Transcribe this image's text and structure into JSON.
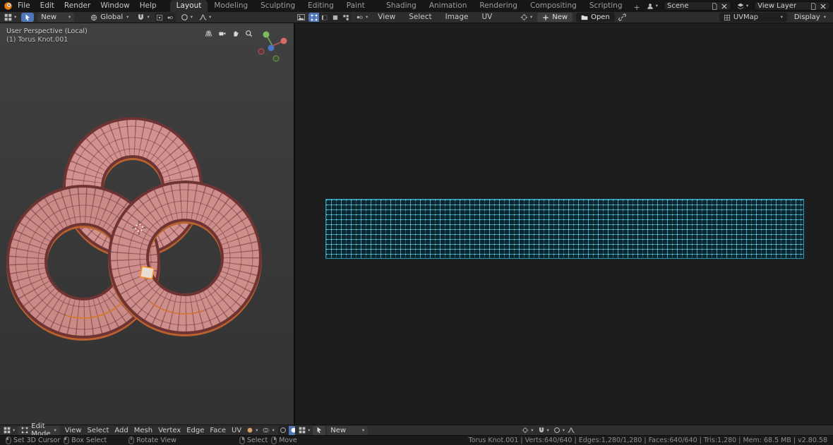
{
  "topbar": {
    "menus": [
      "File",
      "Edit",
      "Render",
      "Window",
      "Help"
    ],
    "tabs": [
      "Layout",
      "Modeling",
      "Sculpting",
      "UV Editing",
      "Texture Paint",
      "Shading",
      "Animation",
      "Rendering",
      "Compositing",
      "Scripting"
    ],
    "active_tab": "Layout",
    "add_tab": "+",
    "scene_label": "Scene",
    "view_layer_label": "View Layer"
  },
  "tools": {
    "new_label": "New",
    "orientation": "Global"
  },
  "uv": {
    "menus": [
      "View",
      "Select",
      "Image",
      "UV"
    ],
    "new_button": "New",
    "open_button": "Open",
    "uvmap": "UVMap",
    "display": "Display",
    "image_new": "New"
  },
  "vp": {
    "view_label": "User Perspective (Local)",
    "object_label": "(1) Torus Knot.001",
    "mode": "Edit Mode",
    "menus": [
      "View",
      "Select",
      "Add",
      "Mesh",
      "Vertex",
      "Edge",
      "Face",
      "UV"
    ]
  },
  "status": {
    "set_cursor": "Set 3D Cursor",
    "box_select": "Box Select",
    "rotate_view": "Rotate View",
    "select": "Select",
    "move": "Move",
    "stats": "Torus Knot.001 | Verts:640/640 | Edges:1,280/1,280 | Faces:640/640 | Tris:1,280 | Mem: 68.5 MB | v2.80.58"
  },
  "colors": {
    "accent_blue": "#4f76b8",
    "mesh_fill": "#cf8f8d",
    "mesh_edge": "#6e3434",
    "selection_orange": "#e8822e",
    "uv_line": "#3aa0b8",
    "uv_vertex": "#a8ecff",
    "viewport_bg": "#3a3a3a",
    "uv_bg": "#1d1d1d"
  },
  "icons": {
    "blender-logo": "orange circle logo",
    "cursor-icon": "white arrow pointer",
    "magnet-icon": "snapping magnet",
    "proportional-icon": "circle",
    "falloff-icon": "smooth curve",
    "pivot-icon": "crosshair circle",
    "folder-icon": "open folder",
    "plus-icon": "+",
    "link-icon": "chain link",
    "mouse-left-icon": "LMB",
    "mouse-middle-icon": "MMB",
    "mouse-right-icon": "RMB"
  }
}
